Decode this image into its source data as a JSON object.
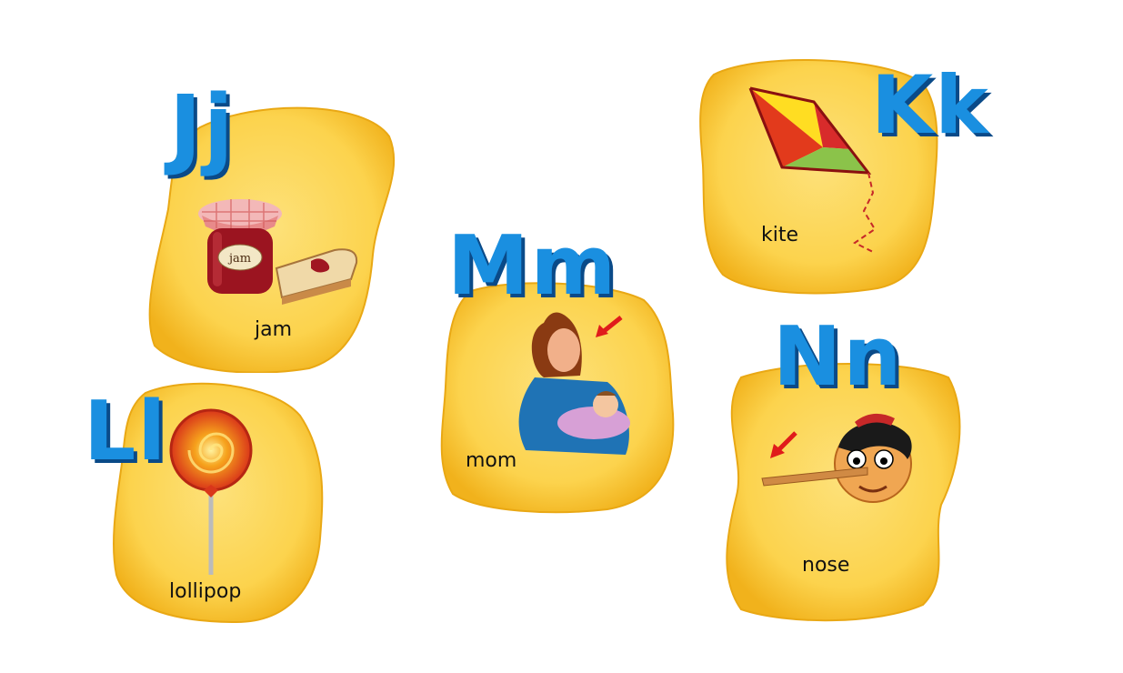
{
  "cards": {
    "j": {
      "letter": "Jj",
      "word": "jam",
      "jar_label": "jam",
      "icons": [
        "jam-jar-icon",
        "bread-slice-icon"
      ]
    },
    "k": {
      "letter": "Kk",
      "word": "kite",
      "icons": [
        "kite-icon"
      ]
    },
    "l": {
      "letter": "Ll",
      "word": "lollipop",
      "icons": [
        "lollipop-icon"
      ]
    },
    "m": {
      "letter": "Mm",
      "word": "mom",
      "icons": [
        "mother-with-baby-icon",
        "pointer-arrow-icon"
      ]
    },
    "n": {
      "letter": "Nn",
      "word": "nose",
      "icons": [
        "pinocchio-face-icon",
        "pointer-arrow-icon"
      ]
    }
  },
  "colors": {
    "card_fill": "#fcd34d",
    "card_edge": "#f2b51f",
    "letter_blue": "#1a8fe0",
    "letter_shadow": "#0a4a88",
    "arrow_red": "#e01b1b"
  }
}
